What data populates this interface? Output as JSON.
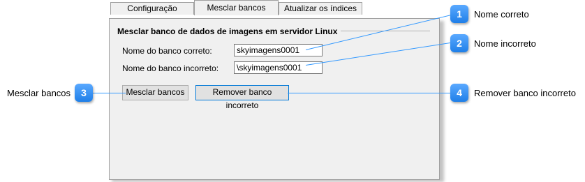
{
  "tabs": [
    {
      "label": "Configuração"
    },
    {
      "label": "Mesclar bancos"
    },
    {
      "label": "Atualizar os índices"
    }
  ],
  "group": {
    "title": "Mesclar banco de dados de imagens em servidor Linux"
  },
  "fields": {
    "correct_label": "Nome do banco correto:",
    "correct_value": "skyimagens0001",
    "incorrect_label": "Nome do banco incorreto:",
    "incorrect_value": "\\skyimagens0001"
  },
  "buttons": {
    "merge": "Mesclar bancos",
    "remove": "Remover banco incorreto"
  },
  "callouts": [
    {
      "number": "1",
      "text": "Nome correto"
    },
    {
      "number": "2",
      "text": "Nome incorreto"
    },
    {
      "number": "3",
      "text": "Mesclar bancos"
    },
    {
      "number": "4",
      "text": "Remover banco incorreto"
    }
  ],
  "colors": {
    "callout": "#1f7fe8",
    "panel": "#f0f0f0"
  }
}
